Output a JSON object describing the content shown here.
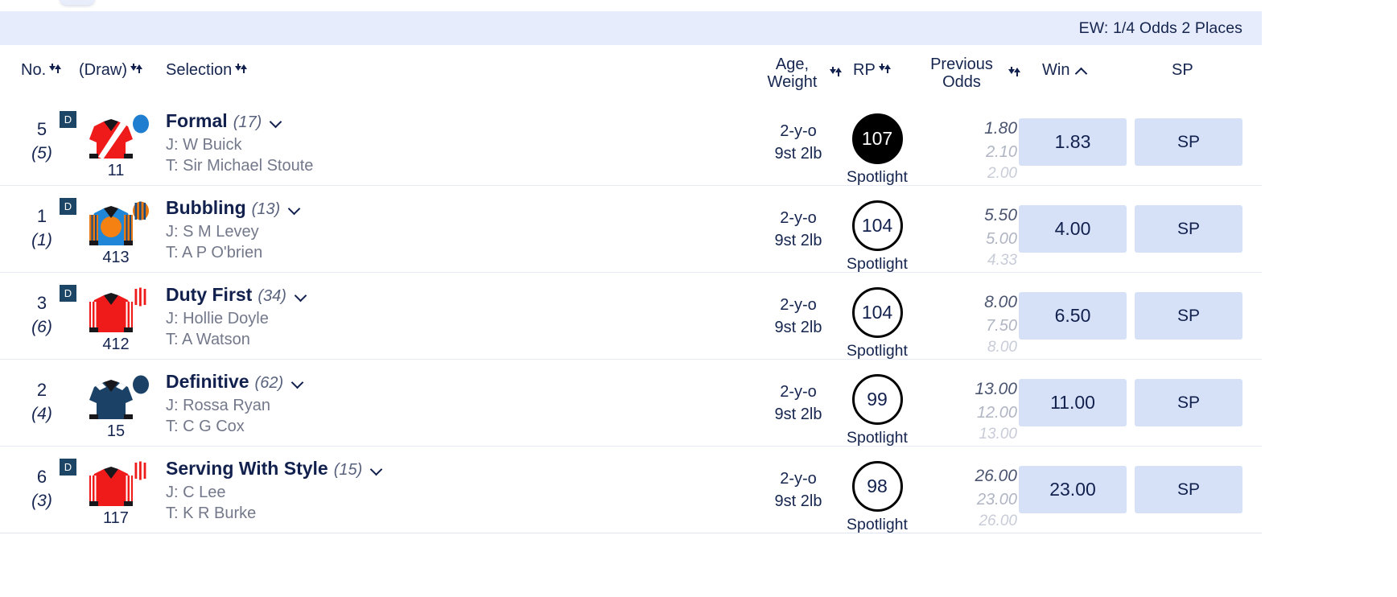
{
  "banner": {
    "ew_terms": "EW: 1/4 Odds 2 Places"
  },
  "table_header": {
    "no": "No.",
    "draw": "(Draw)",
    "selection": "Selection",
    "age_weight": "Age,\nWeight",
    "rp": "RP",
    "previous_odds": "Previous\nOdds",
    "win": "Win",
    "sp": "SP",
    "win_sort_direction": "ascending"
  },
  "colors": {
    "banner_bg": "#e6ecfb",
    "odds_button_bg": "#d6e1f8",
    "text_navy": "#11204d",
    "muted_gray": "#73788a",
    "d_badge_bg": "#1d4666"
  },
  "runners": [
    {
      "number": "5",
      "draw": "(5)",
      "d_badge": "D",
      "form_figures": "11",
      "name": "Formal",
      "or_rating": "(17)",
      "jockey": "J: W Buick",
      "trainer": "T: Sir Michael Stoute",
      "age": "2-y-o",
      "weight": "9st 2lb",
      "rp": "107",
      "rp_style": "filled",
      "spotlight": "Spotlight",
      "previous_odds": [
        "1.80",
        "2.10",
        "2.00"
      ],
      "win": "1.83",
      "sp": "SP",
      "silks": "red-white-sash-blue-cap"
    },
    {
      "number": "1",
      "draw": "(1)",
      "d_badge": "D",
      "form_figures": "413",
      "name": "Bubbling",
      "or_rating": "(13)",
      "jockey": "J: S M Levey",
      "trainer": "T: A P O'brien",
      "age": "2-y-o",
      "weight": "9st 2lb",
      "rp": "104",
      "rp_style": "outline",
      "spotlight": "Spotlight",
      "previous_odds": [
        "5.50",
        "5.00",
        "4.33"
      ],
      "win": "4.00",
      "sp": "SP",
      "silks": "blue-orange-disc-striped-cap"
    },
    {
      "number": "3",
      "draw": "(6)",
      "d_badge": "D",
      "form_figures": "412",
      "name": "Duty First",
      "or_rating": "(34)",
      "jockey": "J: Hollie Doyle",
      "trainer": "T: A Watson",
      "age": "2-y-o",
      "weight": "9st 2lb",
      "rp": "104",
      "rp_style": "outline",
      "spotlight": "Spotlight",
      "previous_odds": [
        "8.00",
        "7.50",
        "8.00"
      ],
      "win": "6.50",
      "sp": "SP",
      "silks": "red-white-stripe-sleeves-striped-cap"
    },
    {
      "number": "2",
      "draw": "(4)",
      "d_badge": "",
      "form_figures": "15",
      "name": "Definitive",
      "or_rating": "(62)",
      "jockey": "J: Rossa Ryan",
      "trainer": "T: C G Cox",
      "age": "2-y-o",
      "weight": "9st 2lb",
      "rp": "99",
      "rp_style": "outline",
      "spotlight": "Spotlight",
      "previous_odds": [
        "13.00",
        "12.00",
        "13.00"
      ],
      "win": "11.00",
      "sp": "SP",
      "silks": "navy-white-epaulettes-navy-cap"
    },
    {
      "number": "6",
      "draw": "(3)",
      "d_badge": "D",
      "form_figures": "117",
      "name": "Serving With Style",
      "or_rating": "(15)",
      "jockey": "J: C Lee",
      "trainer": "T: K R Burke",
      "age": "2-y-o",
      "weight": "9st 2lb",
      "rp": "98",
      "rp_style": "outline",
      "spotlight": "Spotlight",
      "previous_odds": [
        "26.00",
        "23.00",
        "26.00"
      ],
      "win": "23.00",
      "sp": "SP",
      "silks": "red-white-stripe-sleeves-striped-cap"
    }
  ]
}
